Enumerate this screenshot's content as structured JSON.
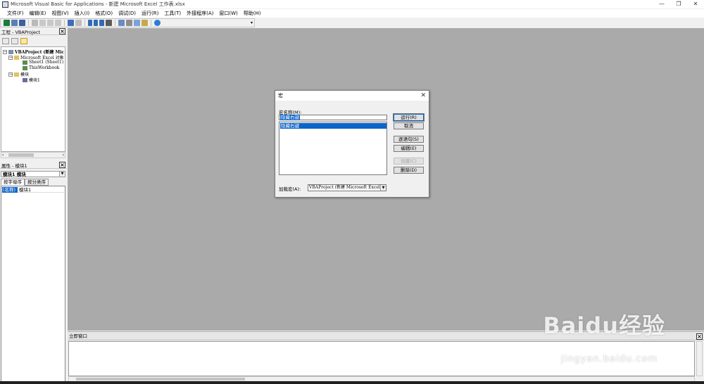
{
  "window": {
    "title": "Microsoft Visual Basic for Applications - 新建 Microsoft Excel 工作表.xlsx",
    "min": "—",
    "restore": "❐",
    "close": "✕"
  },
  "menu": [
    "文件(F)",
    "编辑(E)",
    "视图(V)",
    "插入(I)",
    "格式(O)",
    "调试(D)",
    "运行(R)",
    "工具(T)",
    "外接程序(A)",
    "窗口(W)",
    "帮助(H)"
  ],
  "project": {
    "title": "工程 - VBAProject",
    "root": "VBAProject (新建 Mic",
    "excel_objects": "Microsoft Excel 对象",
    "sheet1": "Sheet1 (Sheet1)",
    "workbook": "ThisWorkbook",
    "modules": "模块",
    "module1": "模块1"
  },
  "properties": {
    "title": "属性 - 模块1",
    "object": "模块1 模块",
    "tabs": [
      "按字母序",
      "按分类序"
    ],
    "row_key": "(名称)",
    "row_value": "模块1"
  },
  "dialog": {
    "title": "宏",
    "close": "✕",
    "name_label": "宏名称(M):",
    "name_value": "隐藏右键",
    "list_items": [
      "隐藏右键"
    ],
    "buttons": {
      "run": "运行(R)",
      "cancel": "取消",
      "step": "逐语句(S)",
      "edit": "编辑(E)",
      "create": "创建(C)",
      "delete": "删除(D)"
    },
    "macros_in_label": "加载宏(A):",
    "macros_in_value": "VBAProject (新建 Microsoft Excel"
  },
  "immediate": {
    "title": "立即窗口"
  },
  "watermark": {
    "main": "Baidu经验",
    "sub": "jingyan.baidu.com"
  },
  "colors": {
    "accent": "#0b64c8",
    "workspace": "#aaaaaa"
  }
}
